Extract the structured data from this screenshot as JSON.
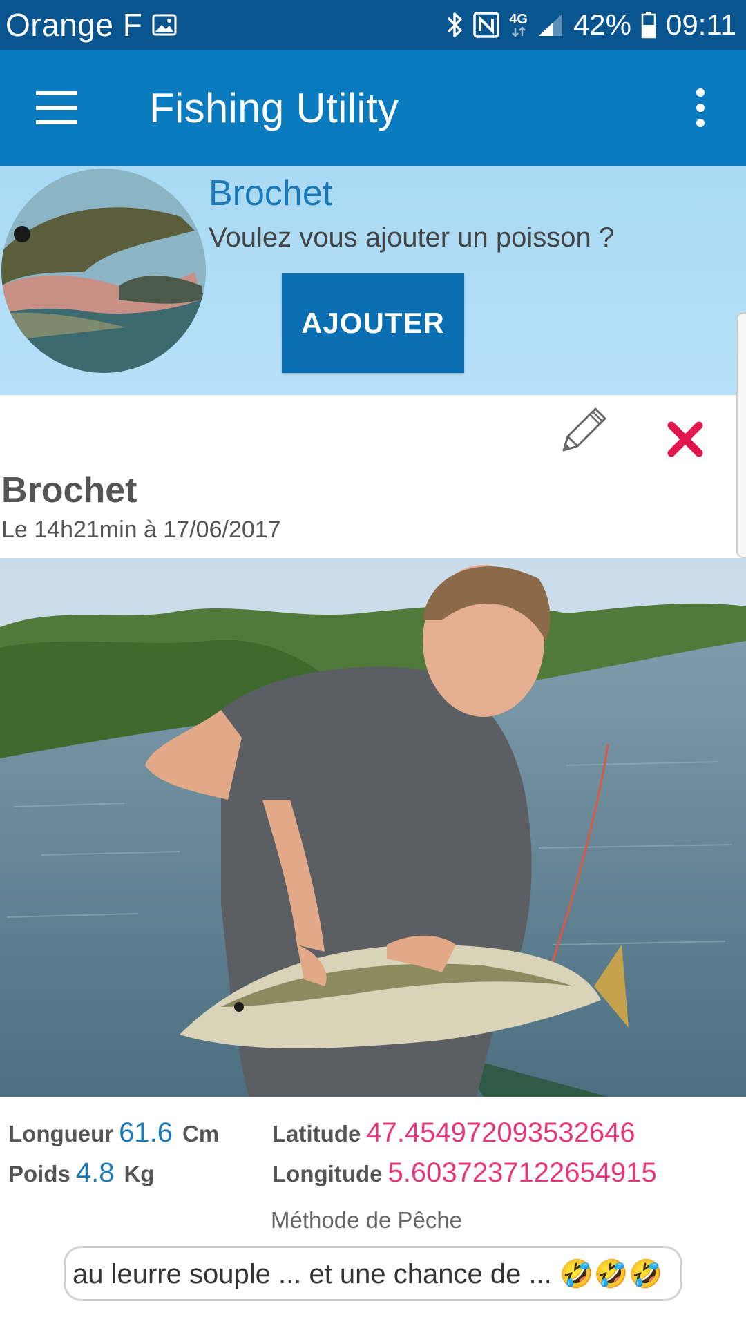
{
  "status_bar": {
    "carrier": "Orange F",
    "network": "4G",
    "battery": "42%",
    "time": "09:11",
    "icons": [
      "image-icon",
      "bluetooth-icon",
      "nfc-icon",
      "signal-icon",
      "battery-icon"
    ]
  },
  "app_bar": {
    "title": "Fishing Utility",
    "menu_icon": "hamburger-icon",
    "more_icon": "more-vert-icon",
    "color": "#0a7bbf"
  },
  "header": {
    "species": "Brochet",
    "question": "Voulez vous ajouter un poisson ?",
    "add_button": "AJOUTER"
  },
  "catch": {
    "title": "Brochet",
    "date": "Le 14h21min à 17/06/2017",
    "edit_icon": "pencil-icon",
    "delete_icon": "close-icon",
    "length_label": "Longueur",
    "length_value": "61.6",
    "length_unit": "Cm",
    "weight_label": "Poids",
    "weight_value": "4.8",
    "weight_unit": "Kg",
    "latitude_label": "Latitude",
    "latitude_value": "47.454972093532646",
    "longitude_label": "Longitude",
    "longitude_value": "5.6037237122654915",
    "method_label": "Méthode de Pêche",
    "method_value": "au leurre souple ... et une chance de ... 🤣🤣🤣"
  },
  "colors": {
    "accent_blue": "#1a77b8",
    "value_pink": "#e8357a",
    "delete_red": "#e0174f"
  }
}
